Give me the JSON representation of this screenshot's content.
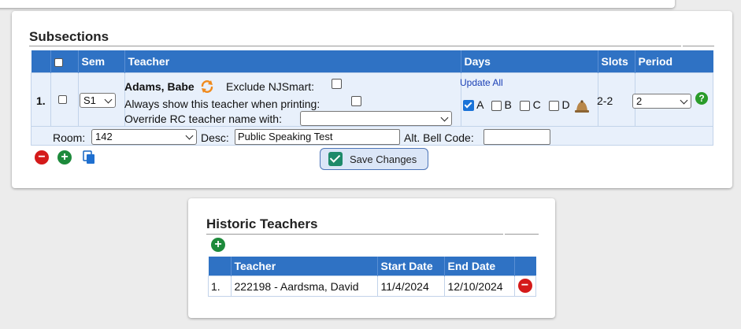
{
  "subsections": {
    "title": "Subsections",
    "headers": {
      "sem": "Sem",
      "teacher": "Teacher",
      "days": "Days",
      "slots": "Slots",
      "period": "Period"
    },
    "row": {
      "index": "1.",
      "sem": "S1",
      "teacher_name": "Adams, Babe",
      "exclude_label": "Exclude NJSmart:",
      "always_show_label": "Always show this teacher when printing:",
      "override_label": "Override RC teacher name with:",
      "override_value": "",
      "update_all": "Update All",
      "days": [
        {
          "label": "A",
          "checked": true
        },
        {
          "label": "B",
          "checked": false
        },
        {
          "label": "C",
          "checked": false
        },
        {
          "label": "D",
          "checked": false
        }
      ],
      "slots": "2-2",
      "period": "2",
      "room_label": "Room:",
      "room_value": "142",
      "desc_label": "Desc:",
      "desc_value": "Public Speaking Test",
      "alt_bell_label": "Alt. Bell Code:",
      "alt_bell_value": ""
    },
    "save_button": "Save Changes"
  },
  "historic": {
    "title": "Historic Teachers",
    "headers": {
      "teacher": "Teacher",
      "start": "Start Date",
      "end": "End Date"
    },
    "rows": [
      {
        "index": "1.",
        "teacher": "222198 - Aardsma, David",
        "start": "11/4/2024",
        "end": "12/10/2024"
      }
    ]
  },
  "icons": {
    "refresh": "refresh-icon",
    "bell": "bell-icon",
    "help": "help-icon",
    "remove": "remove-icon",
    "add": "add-icon",
    "copy": "copy-icon",
    "check": "check-icon"
  },
  "colors": {
    "header_blue": "#2f72c4",
    "row_bg": "#e8f0fb",
    "remove_red": "#d41a1a",
    "add_green": "#1d8a3b"
  }
}
